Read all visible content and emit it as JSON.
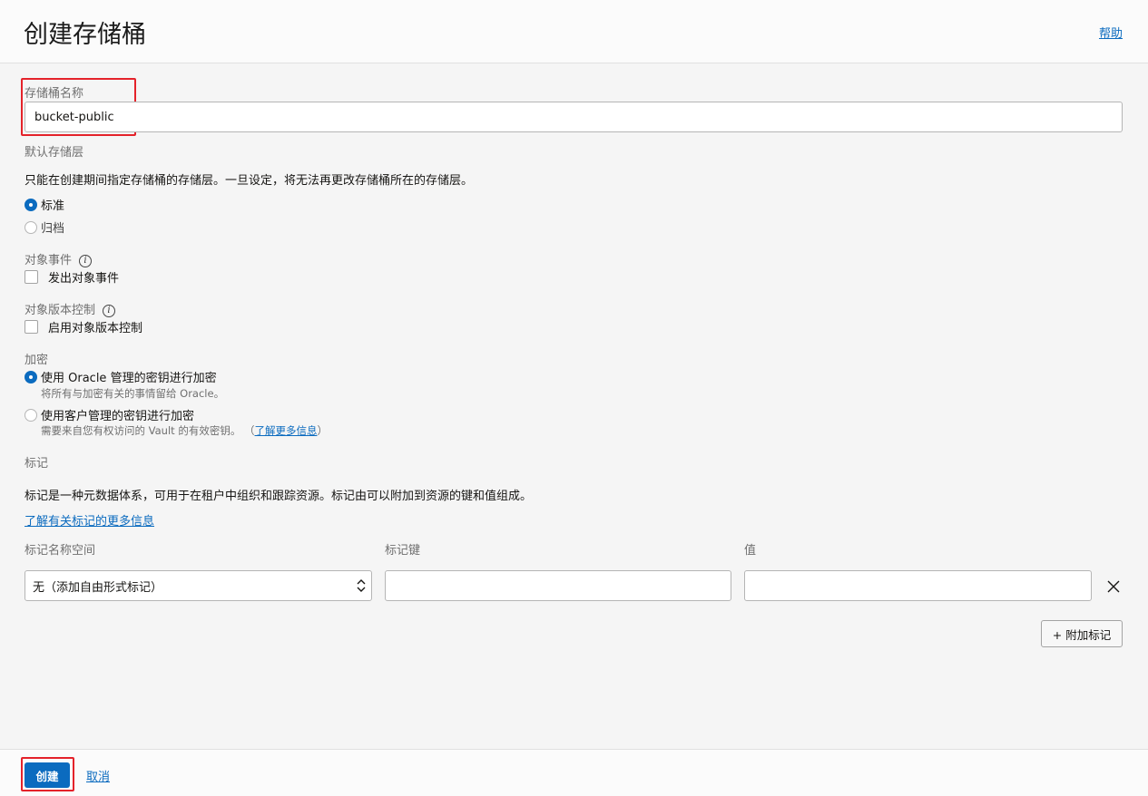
{
  "header": {
    "title": "创建存储桶",
    "help": "帮助"
  },
  "bucket_name": {
    "label": "存储桶名称",
    "value": "bucket-public"
  },
  "storage_tier": {
    "label": "默认存储层",
    "description": "只能在创建期间指定存储桶的存储层。一旦设定，将无法再更改存储桶所在的存储层。",
    "options": [
      {
        "label": "标准",
        "checked": true
      },
      {
        "label": "归档",
        "checked": false
      }
    ]
  },
  "object_events": {
    "label": "对象事件",
    "checkbox": "发出对象事件",
    "info": "i"
  },
  "object_versioning": {
    "label": "对象版本控制",
    "checkbox": "启用对象版本控制",
    "info": "i"
  },
  "encryption": {
    "label": "加密",
    "option_oracle": {
      "label": "使用 Oracle 管理的密钥进行加密",
      "sub": "将所有与加密有关的事情留给 Oracle。",
      "checked": true
    },
    "option_customer": {
      "label": "使用客户管理的密钥进行加密",
      "sub": "需要来自您有权访问的 Vault 的有效密钥。",
      "link_open": "（",
      "link": "了解更多信息",
      "link_close": "）",
      "checked": false
    }
  },
  "tags": {
    "label": "标记",
    "description": "标记是一种元数据体系，可用于在租户中组织和跟踪资源。标记由可以附加到资源的键和值组成。",
    "learn_more": "了解有关标记的更多信息",
    "col_namespace": "标记名称空间",
    "col_key": "标记键",
    "col_value": "值",
    "namespace_value": "无（添加自由形式标记）",
    "add_button": "+ 附加标记"
  },
  "footer": {
    "create": "创建",
    "cancel": "取消"
  },
  "colors": {
    "primary": "#0b6bbf",
    "highlight": "#e4222a"
  }
}
